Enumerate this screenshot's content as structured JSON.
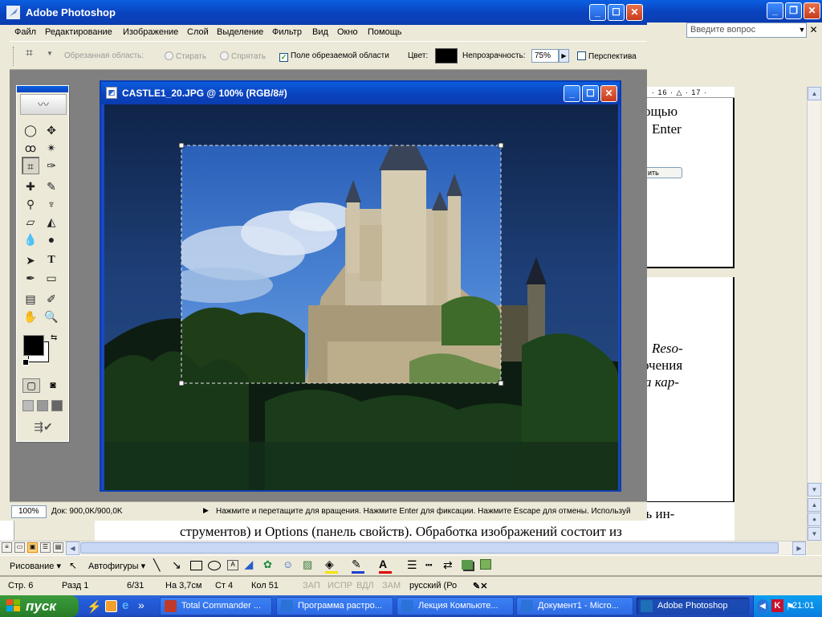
{
  "word": {
    "ask_placeholder": "Введите вопрос",
    "ruler_text": "· 16 · △ · 17 ·",
    "right_text_lines": [
      "ощью",
      "Enter",
      "ить",
      "Reso-",
      "очения",
      "а кар-"
    ],
    "bottom_text_lines": [
      "трезк изобр; в програмах имеется две панели: Toolbox (панель ин-",
      "струментов) и Options (панель свойств). Обработка изображений состоит из"
    ],
    "bottom_line1_visible": "ль ин-",
    "drawing_bar": {
      "draw_label": "Рисование ▾",
      "autoshapes_label": "Автофигуры ▾"
    },
    "status": {
      "page": "Стр. 6",
      "section": "Разд 1",
      "pages": "6/31",
      "at": "На 3,7см",
      "line": "Ст 4",
      "col": "Кол 51",
      "rec": "ЗАП",
      "trk": "ИСПР",
      "ext": "ВДЛ",
      "ovr": "ЗАМ",
      "lang": "русский (Ро"
    }
  },
  "taskbar": {
    "start_label": "пуск",
    "tasks": [
      {
        "label": "Total Commander ...",
        "color": "#c0392b"
      },
      {
        "label": "Программа растро...",
        "color": "#2a72d8"
      },
      {
        "label": "Лекция Компьюте...",
        "color": "#2a72d8"
      },
      {
        "label": "Документ1 - Micro...",
        "color": "#2a72d8"
      },
      {
        "label": "Adobe Photoshop",
        "color": "#1f6fb8"
      }
    ],
    "clock": "21:01"
  },
  "photoshop": {
    "title": "Adobe Photoshop",
    "menu": [
      "Файл",
      "Редактирование",
      "Изображение",
      "Слой",
      "Выделение",
      "Фильтр",
      "Вид",
      "Окно",
      "Помощь"
    ],
    "options": {
      "cropped_area_label": "Обрезанная область:",
      "delete_label": "Стирать",
      "hide_label": "Спрятать",
      "shield_label": "Поле обрезаемой области",
      "color_label": "Цвет:",
      "opacity_label": "Непрозрачность:",
      "opacity_value": "75%",
      "perspective_label": "Перспектива"
    },
    "document": {
      "title": "CASTLE1_20.JPG @ 100% (RGB/8#)"
    },
    "status": {
      "zoom": "100%",
      "doc_size": "Док: 900,0K/900,0K",
      "hint": "Нажмите и перетащите для вращения. Нажмите Enter для фиксации. Нажмите Escape для отмены. Используй"
    }
  }
}
